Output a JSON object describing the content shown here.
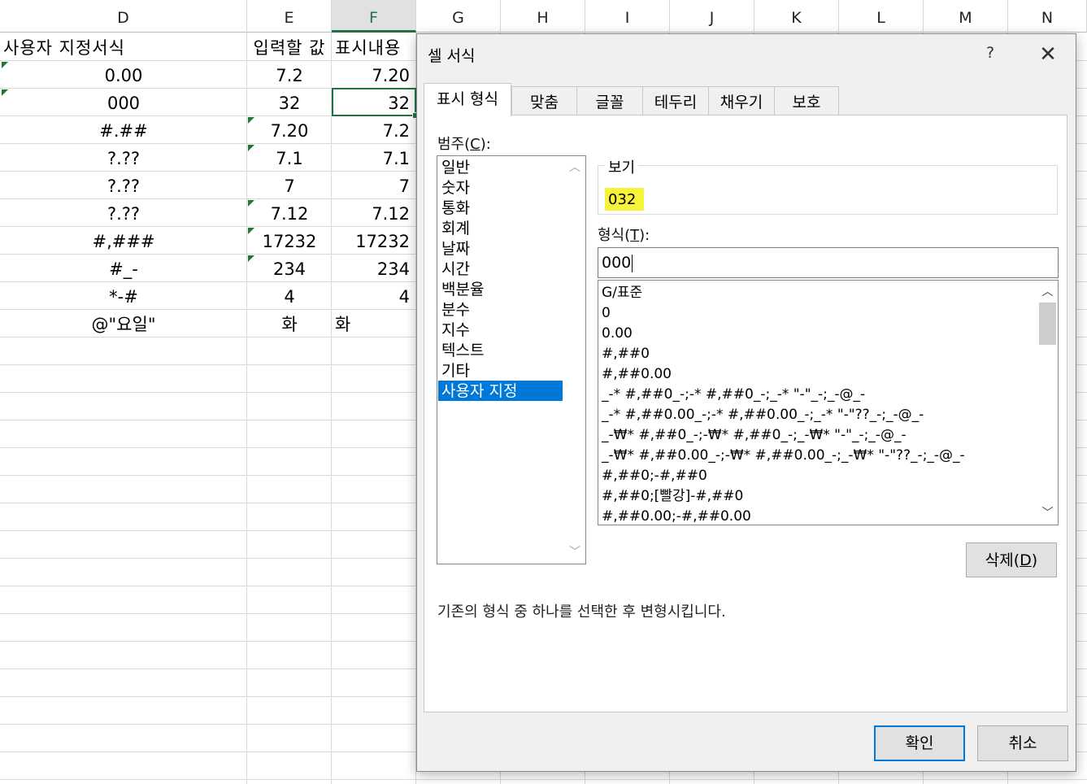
{
  "sheet": {
    "columns": [
      {
        "label": "D"
      },
      {
        "label": "E"
      },
      {
        "label": "F"
      },
      {
        "label": "G"
      },
      {
        "label": "H"
      },
      {
        "label": "I"
      },
      {
        "label": "J"
      },
      {
        "label": "K"
      },
      {
        "label": "L"
      },
      {
        "label": "M"
      },
      {
        "label": "N"
      }
    ],
    "selected_column": "F",
    "rows": [
      {
        "d": "사용자 지정서식",
        "e": "입력할 값",
        "f": "표시내용"
      },
      {
        "d": "0.00",
        "e": "7.2",
        "f": "7.20"
      },
      {
        "d": "000",
        "e": "32",
        "f": "32"
      },
      {
        "d": "#.##",
        "e": "7.20",
        "f": "7.2"
      },
      {
        "d": "?.??",
        "e": "7.1",
        "f": "7.1"
      },
      {
        "d": "?.??",
        "e": "7",
        "f": "7"
      },
      {
        "d": "?.??",
        "e": "7.12",
        "f": "7.12"
      },
      {
        "d": "#,###",
        "e": "17232",
        "f": "17232"
      },
      {
        "d": "#_-",
        "e": "234",
        "f": "234"
      },
      {
        "d": "*-#",
        "e": "4",
        "f": "4"
      },
      {
        "d": "@\"요일\"",
        "e": "화",
        "f": "화"
      }
    ],
    "accent_color": "#217346"
  },
  "dialog": {
    "title": "셀 서식",
    "help_label": "?",
    "close_label": "✕",
    "tabs": [
      {
        "label": "표시 형식"
      },
      {
        "label": "맞춤"
      },
      {
        "label": "글꼴"
      },
      {
        "label": "테두리"
      },
      {
        "label": "채우기"
      },
      {
        "label": "보호"
      }
    ],
    "active_tab": "표시 형식",
    "category_label_text": "범주(",
    "category_label_key": "C",
    "category_label_end": "):",
    "categories": [
      {
        "label": "일반"
      },
      {
        "label": "숫자"
      },
      {
        "label": "통화"
      },
      {
        "label": "회계"
      },
      {
        "label": "날짜"
      },
      {
        "label": "시간"
      },
      {
        "label": "백분율"
      },
      {
        "label": "분수"
      },
      {
        "label": "지수"
      },
      {
        "label": "텍스트"
      },
      {
        "label": "기타"
      },
      {
        "label": "사용자 지정"
      }
    ],
    "selected_category": "사용자 지정",
    "preview_label": "보기",
    "preview_value": "032",
    "preview_highlight_color": "#f7f33a",
    "type_label_text": "형식(",
    "type_label_key": "T",
    "type_label_end": "):",
    "type_input_value": "000",
    "format_list": [
      {
        "label": "G/표준"
      },
      {
        "label": "0"
      },
      {
        "label": "0.00"
      },
      {
        "label": "#,##0"
      },
      {
        "label": "#,##0.00"
      },
      {
        "label": "_-* #,##0_-;-* #,##0_-;_-* \"-\"_-;_-@_-"
      },
      {
        "label": "_-* #,##0.00_-;-* #,##0.00_-;_-* \"-\"??_-;_-@_-"
      },
      {
        "label": "_-₩* #,##0_-;-₩* #,##0_-;_-₩* \"-\"_-;_-@_-"
      },
      {
        "label": "_-₩* #,##0.00_-;-₩* #,##0.00_-;_-₩* \"-\"??_-;_-@_-"
      },
      {
        "label": "#,##0;-#,##0"
      },
      {
        "label": "#,##0;[빨강]-#,##0"
      },
      {
        "label": "#,##0.00;-#,##0.00"
      }
    ],
    "delete_label_text": "삭제(",
    "delete_label_key": "D",
    "delete_label_end": ")",
    "description": "기존의 형식 중 하나를 선택한 후 변형시킵니다.",
    "ok_label": "확인",
    "cancel_label": "취소",
    "selection_color": "#0078d7"
  }
}
